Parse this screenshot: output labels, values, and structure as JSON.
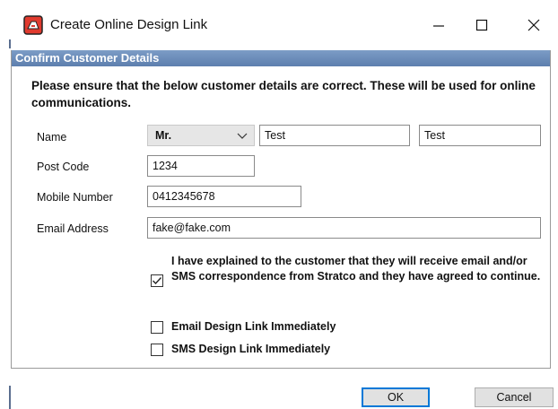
{
  "window": {
    "title": "Create Online Design Link",
    "icon": "stratco-logo-icon",
    "accent": "#e03a2e"
  },
  "panel": {
    "header": "Confirm Customer Details",
    "intro": "Please ensure that the below customer details are correct. These will be used for online communications."
  },
  "form": {
    "name_label": "Name",
    "salutation": "Mr.",
    "first_name": "Test",
    "last_name": "Test",
    "postcode_label": "Post Code",
    "postcode": "1234",
    "mobile_label": "Mobile Number",
    "mobile": "0412345678",
    "email_label": "Email Address",
    "email": "fake@fake.com"
  },
  "checks": {
    "consent": {
      "label": "I have explained to the customer that they will receive email and/or SMS correspondence from Stratco and they have agreed to continue.",
      "checked": true
    },
    "email_link": {
      "label": "Email Design Link Immediately",
      "checked": false
    },
    "sms_link": {
      "label": "SMS Design Link Immediately",
      "checked": false
    }
  },
  "buttons": {
    "ok": "OK",
    "cancel": "Cancel"
  },
  "colors": {
    "header_bg": "#6a8cba",
    "default_button_border": "#0078d7"
  }
}
